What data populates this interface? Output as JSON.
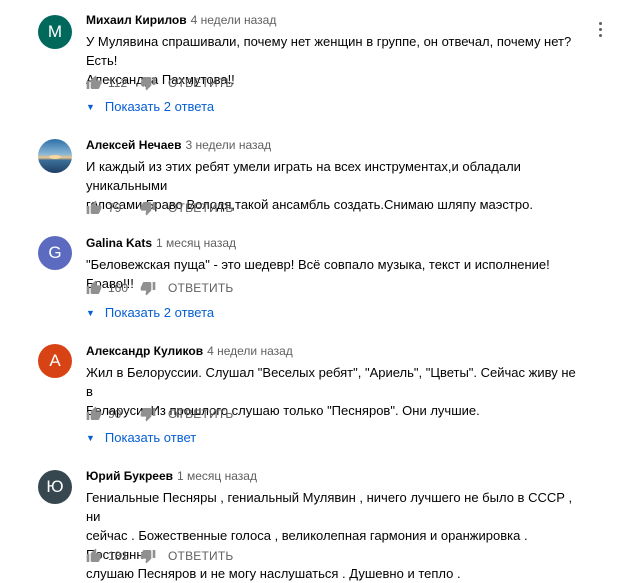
{
  "comments": [
    {
      "author": "Михаил Кирилов",
      "time": "4 недели назад",
      "avatar_letter": "М",
      "avatar_color": "#00695c",
      "text_lines": [
        "У Мулявина спрашивали, почему нет женщин в группе, он отвечал, почему нет?  Есть!",
        "Александра Пахмутова!!"
      ],
      "likes": "112",
      "reply_label": "ОТВЕТИТЬ",
      "show_replies": "Показать 2 ответа"
    },
    {
      "author": "Алексей Нечаев",
      "time": "3 недели назад",
      "avatar_image": "seascape-photo",
      "text_lines": [
        "И каждый из этих ребят умели играть на всех инструментах,и обладали уникальными",
        "голосами.Браво Володя,такой ансамбль создать.Снимаю шляпу маэстро."
      ],
      "likes": "79",
      "reply_label": "ОТВЕТИТЬ"
    },
    {
      "author": "Galina Kats",
      "time": "1 месяц назад",
      "avatar_letter": "G",
      "avatar_color": "#5c6bc0",
      "text_lines": [
        "\"Беловежская пуща\" - это шедевр! Всё совпало музыка, текст и исполнение! Браво!!!"
      ],
      "likes": "160",
      "reply_label": "ОТВЕТИТЬ",
      "show_replies": "Показать 2 ответа"
    },
    {
      "author": "Александр Куликов",
      "time": "4 недели назад",
      "avatar_letter": "А",
      "avatar_color": "#d84315",
      "text_lines": [
        "Жил в Белоруссии. Слушал \"Веселых ребят\", \"Ариель\", \"Цветы\". Сейчас живу не в",
        "Беларуси. Из прошлого слушаю только \"Песняров\". Они лучшие."
      ],
      "likes": "90",
      "reply_label": "ОТВЕТИТЬ",
      "show_replies": "Показать ответ"
    },
    {
      "author": "Юрий Букреев",
      "time": "1 месяц назад",
      "avatar_letter": "Ю",
      "avatar_color": "#37474f",
      "text_lines": [
        "Гениальные Песняры , гениальный Мулявин , ничего лучшего не было в СССР , ни",
        "сейчас . Божественные голоса , великолепная гармония и оранжировка . Постоянно",
        "слушаю Песняров и не могу наслушаться . Душевно и тепло ."
      ],
      "likes": "131",
      "reply_label": "ОТВЕТИТЬ"
    }
  ]
}
